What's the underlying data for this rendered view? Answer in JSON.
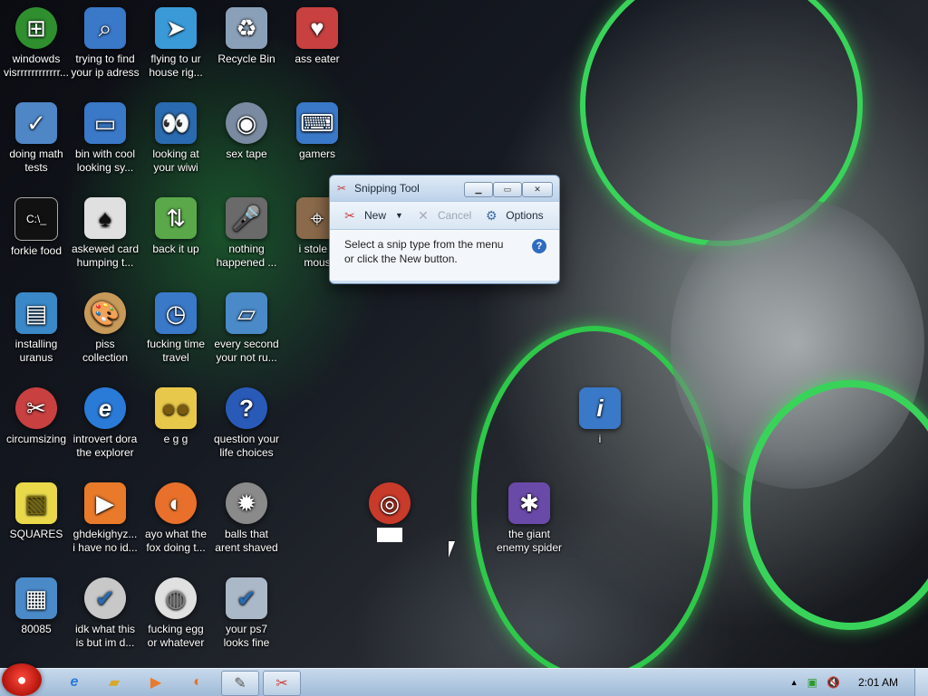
{
  "desktop": {
    "icons": [
      {
        "label": "windowds\nvisrrrrrrrrrrrr...",
        "icon": "windows-logo-icon",
        "color": "#2f8f2f"
      },
      {
        "label": "trying to find\nyour ip adress",
        "icon": "network-search-icon",
        "color": "#3a78c8"
      },
      {
        "label": "flying to ur\nhouse rig...",
        "icon": "paper-plane-icon",
        "color": "#3a9ad8"
      },
      {
        "label": "Recycle Bin",
        "icon": "recycle-bin-icon",
        "color": "#8aa0b8"
      },
      {
        "label": "ass eater",
        "icon": "solitaire-cards-icon",
        "color": "#c84040"
      },
      {
        "label": "doing math\ntests",
        "icon": "chart-icon",
        "color": "#4e86c6"
      },
      {
        "label": "bin with cool\nlooking sy...",
        "icon": "computer-icon",
        "color": "#3a78c8"
      },
      {
        "label": "looking at\nyour wiwi",
        "icon": "eyes-icon",
        "color": "#2a6ab0"
      },
      {
        "label": "sex tape",
        "icon": "disc-icon",
        "color": "#7a8aa0"
      },
      {
        "label": "gamers",
        "icon": "monitor-keyboard-icon",
        "color": "#3a78c8"
      },
      {
        "label": "forkie food",
        "icon": "command-prompt-icon",
        "color": "#111111"
      },
      {
        "label": "askewed card\nhumping t...",
        "icon": "playing-card-icon",
        "color": "#e0e0e0"
      },
      {
        "label": "back it up",
        "icon": "backup-drive-icon",
        "color": "#5aa84a"
      },
      {
        "label": "nothing\nhappened ...",
        "icon": "microphone-icon",
        "color": "#6a6a6a"
      },
      {
        "label": "i stole y\nmous",
        "icon": "mouse-icon",
        "color": "#8a6a4a"
      },
      {
        "label": "installing\nuranus",
        "icon": "installer-icon",
        "color": "#3a88c8"
      },
      {
        "label": "piss\ncollection",
        "icon": "paint-palette-icon",
        "color": "#c89a5a"
      },
      {
        "label": "fucking time\ntravel",
        "icon": "clock-computer-icon",
        "color": "#3a78c8"
      },
      {
        "label": "every second\nyour not ru...",
        "icon": "tablet-icon",
        "color": "#4a8ac8"
      },
      {
        "label": "circumsizing",
        "icon": "scissors-icon",
        "color": "#c84040"
      },
      {
        "label": "introvert dora\nthe explorer",
        "icon": "internet-explorer-icon",
        "color": "#2a7ad8"
      },
      {
        "label": "e g g",
        "icon": "folder-eggs-icon",
        "color": "#e8c84a"
      },
      {
        "label": "question your\nlife choices",
        "icon": "help-question-icon",
        "color": "#2a5ab8"
      },
      {
        "label": "i",
        "icon": "info-monitor-icon",
        "color": "#3a78c8"
      },
      {
        "label": "SQUARES",
        "icon": "sticky-notes-icon",
        "color": "#e8d84a"
      },
      {
        "label": "ghdekighyz...\ni have no id...",
        "icon": "media-player-icon",
        "color": "#e87a2a"
      },
      {
        "label": "ayo what the\nfox doing t...",
        "icon": "firefox-icon",
        "color": "#e8702a"
      },
      {
        "label": "balls that\narent shaved",
        "icon": "spiked-ball-icon",
        "color": "#8a8a8a"
      },
      {
        "label": "",
        "icon": "target-icon",
        "color": "#c83a2a"
      },
      {
        "label": "the giant\nenemy spider",
        "icon": "spider-solitaire-icon",
        "color": "#6a4aa8"
      },
      {
        "label": "80085",
        "icon": "calculator-icon",
        "color": "#4a8ac8"
      },
      {
        "label": "idk what this\nis but im d...",
        "icon": "disc-check-icon",
        "color": "#c8c8c8"
      },
      {
        "label": "fucking egg\nor whatever",
        "icon": "egg-icon",
        "color": "#e0e0e0"
      },
      {
        "label": "your ps7\nlooks fine",
        "icon": "drive-check-icon",
        "color": "#aab8c8"
      }
    ]
  },
  "snipping_tool": {
    "title": "Snipping Tool",
    "new_label": "New",
    "cancel_label": "Cancel",
    "options_label": "Options",
    "message_line1": "Select a snip type from the menu",
    "message_line2": "or click the New button."
  },
  "taskbar": {
    "clock": "2:01 AM"
  }
}
